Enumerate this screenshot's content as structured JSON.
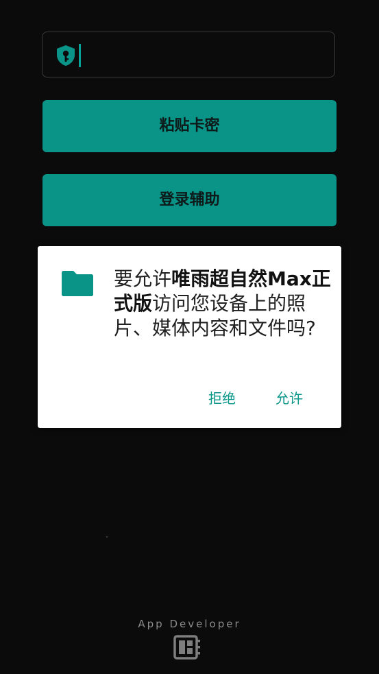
{
  "key_input": {
    "value": "",
    "placeholder": "",
    "icon": "shield-key-icon"
  },
  "buttons": {
    "paste": "粘贴卡密",
    "login": "登录辅助"
  },
  "permission_dialog": {
    "icon": "folder-icon",
    "message_prefix": "要允许",
    "app_name": "唯雨超自然Max正式版",
    "message_suffix": "访问您设备上的照片、媒体内容和文件吗?",
    "deny_label": "拒绝",
    "allow_label": "允许"
  },
  "footer": {
    "text": "App Developer",
    "icon": "developer-board-icon"
  },
  "colors": {
    "background": "#0b0b0c",
    "accent": "#0a9387",
    "dialog_button": "#0a968a",
    "field_border": "#3b3b3d"
  }
}
